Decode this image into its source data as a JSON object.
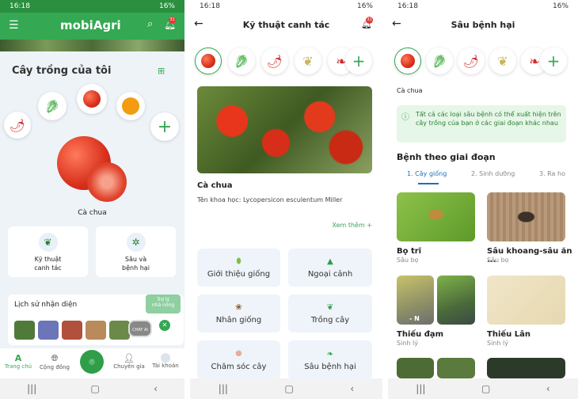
{
  "status_bar": {
    "time": "16:18",
    "battery": "16%"
  },
  "home": {
    "brand": "mobiAgri",
    "notification_count": "31",
    "my_crops_title": "Cây trồng của tôi",
    "selected_crop": "Cà chua",
    "cards": [
      {
        "label": "Kỹ thuật\ncanh tác"
      },
      {
        "label": "Sâu và\nbệnh hại"
      }
    ],
    "history_title": "Lịch sử nhận diện",
    "assistant_bubble": "Trợ lý\nnhà nông",
    "chat_ai_label": "CHAT AI",
    "nav": [
      {
        "label": "Trang chủ"
      },
      {
        "label": "Cộng đồng"
      },
      {
        "label": "Chuyên gia"
      },
      {
        "label": "Tài khoản"
      }
    ],
    "accent": "#2e9e48"
  },
  "technique": {
    "title": "Kỹ thuật canh tác",
    "notification_count": "31",
    "crop_name": "Cà chua",
    "scientific_name": "Tên khoa học: Lycopersicon esculentum Miller",
    "see_more": "Xem thêm  +",
    "items": [
      {
        "label": "Giới thiệu giống"
      },
      {
        "label": "Ngoại cảnh"
      },
      {
        "label": "Nhân giống"
      },
      {
        "label": "Trồng cây"
      },
      {
        "label": "Chăm sóc cây"
      },
      {
        "label": "Sâu bệnh hại"
      }
    ]
  },
  "pests": {
    "title": "Sâu bệnh hại",
    "crop_name": "Cà chua",
    "info": "Tất cả các loại sâu bệnh có thể xuất hiện trên cây trồng của bạn ở các giai đoạn khác nhau",
    "section_title": "Bệnh theo giai đoạn",
    "tabs": [
      {
        "label": "1. Cây giống"
      },
      {
        "label": "2. Sinh dưỡng"
      },
      {
        "label": "3. Ra ho"
      }
    ],
    "items": [
      {
        "name": "Bọ trĩ",
        "type": "Sâu bọ"
      },
      {
        "name": "Sâu khoang-sâu ăn ...",
        "type": "Sâu bọ"
      },
      {
        "name": "Thiếu đạm",
        "type": "Sinh lý"
      },
      {
        "name": "Thiếu Lân",
        "type": "Sinh lý"
      }
    ],
    "image_label_n": "- N"
  }
}
